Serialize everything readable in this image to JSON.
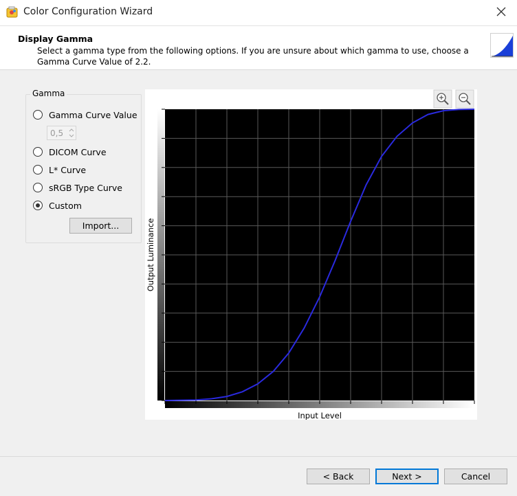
{
  "window": {
    "title": "Color Configuration Wizard",
    "app_icon": "color-wizard-icon",
    "close_icon": "close-icon"
  },
  "header": {
    "title": "Display Gamma",
    "description": "Select a gamma type from the following options. If you are unsure about which gamma to use, choose a Gamma Curve Value of 2.2."
  },
  "gamma": {
    "group_label": "Gamma",
    "options": [
      {
        "label": "Gamma Curve Value",
        "checked": false
      },
      {
        "label": "DICOM Curve",
        "checked": false
      },
      {
        "label": "L* Curve",
        "checked": false
      },
      {
        "label": "sRGB Type Curve",
        "checked": false
      },
      {
        "label": "Custom",
        "checked": true
      }
    ],
    "value": "0,5",
    "import_label": "Import..."
  },
  "plot": {
    "zoom_in_icon": "zoom-in-icon",
    "zoom_out_icon": "zoom-out-icon",
    "background": "#000000",
    "grid_color": "#5a5a5a",
    "curve_color": "#2a2adf"
  },
  "chart_data": {
    "type": "line",
    "xlabel": "Input Level",
    "ylabel": "Output Luminance",
    "xlim": [
      0,
      1
    ],
    "ylim": [
      0,
      1
    ],
    "grid": true,
    "series": [
      {
        "x": [
          0,
          0.05,
          0.1,
          0.15,
          0.2,
          0.25,
          0.3,
          0.35,
          0.4,
          0.45,
          0.5,
          0.55,
          0.6,
          0.65,
          0.7,
          0.75,
          0.8,
          0.85,
          0.9,
          0.95,
          1
        ],
        "values": [
          0,
          0.001,
          0.002,
          0.006,
          0.014,
          0.03,
          0.057,
          0.1,
          0.163,
          0.249,
          0.356,
          0.481,
          0.615,
          0.74,
          0.838,
          0.907,
          0.953,
          0.982,
          0.995,
          0.999,
          1
        ]
      }
    ]
  },
  "footer": {
    "back_label": "< Back",
    "next_label": "Next >",
    "cancel_label": "Cancel"
  }
}
